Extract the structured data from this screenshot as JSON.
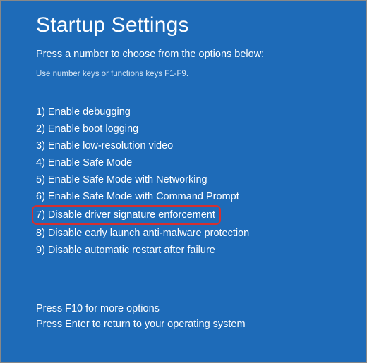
{
  "title": "Startup Settings",
  "subtitle": "Press a number to choose from the options below:",
  "hint": "Use number keys or functions keys F1-F9.",
  "options": [
    {
      "num": "1) ",
      "label": "Enable debugging",
      "highlighted": false
    },
    {
      "num": "2) ",
      "label": "Enable boot logging",
      "highlighted": false
    },
    {
      "num": "3) ",
      "label": "Enable low-resolution video",
      "highlighted": false
    },
    {
      "num": "4) ",
      "label": "Enable Safe Mode",
      "highlighted": false
    },
    {
      "num": "5) ",
      "label": "Enable Safe Mode with Networking",
      "highlighted": false
    },
    {
      "num": "6) ",
      "label": "Enable Safe Mode with Command Prompt",
      "highlighted": false
    },
    {
      "num": "7) ",
      "label": "Disable driver signature enforcement",
      "highlighted": true
    },
    {
      "num": "8) ",
      "label": "Disable early launch anti-malware protection",
      "highlighted": false
    },
    {
      "num": "9) ",
      "label": "Disable automatic restart after failure",
      "highlighted": false
    }
  ],
  "footer": {
    "more": "Press F10 for more options",
    "return": "Press Enter to return to your operating system"
  },
  "colors": {
    "background": "#1e6bb8",
    "highlight_border": "#d43030"
  }
}
